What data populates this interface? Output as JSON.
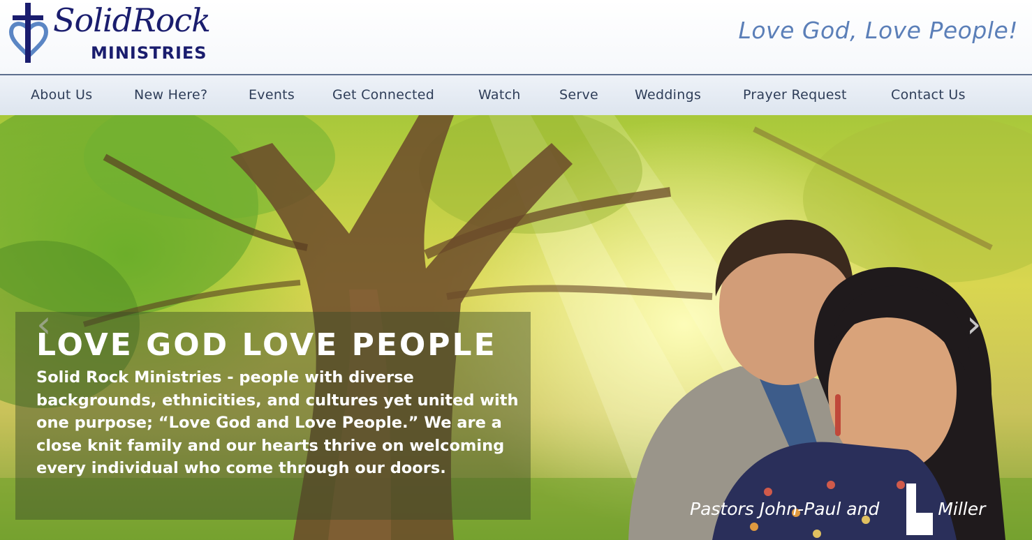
{
  "header": {
    "logo": {
      "title": "SolidRock",
      "subtitle": "MINISTRIES",
      "icon": "cross-heart-icon"
    },
    "tagline": "Love God, Love People!"
  },
  "nav": {
    "items": [
      {
        "label": "About Us"
      },
      {
        "label": "New Here?"
      },
      {
        "label": "Events"
      },
      {
        "label": "Get Connected"
      },
      {
        "label": "Watch"
      },
      {
        "label": "Serve"
      },
      {
        "label": "Weddings"
      },
      {
        "label": "Prayer Request"
      },
      {
        "label": "Contact Us"
      }
    ]
  },
  "hero": {
    "prev_icon": "chevron-left-icon",
    "next_icon": "chevron-right-icon",
    "prev_glyph": "‹",
    "next_glyph": "›",
    "title": "LOVE GOD LOVE PEOPLE",
    "body": "Solid Rock Ministries - people with diverse backgrounds, ethnicities, and cultures yet united with one purpose; “Love God and Love People.” We are a close knit family and our hearts thrive on welcoming every individual who come through our doors.",
    "photo_caption_lead": "Pastors John-Paul and",
    "photo_caption_tail": "Miller"
  },
  "colors": {
    "brand_navy": "#1a1d6e",
    "tagline_blue": "#5b7fb8",
    "nav_text": "#2e3d58",
    "nav_border": "#5d6f8e"
  }
}
